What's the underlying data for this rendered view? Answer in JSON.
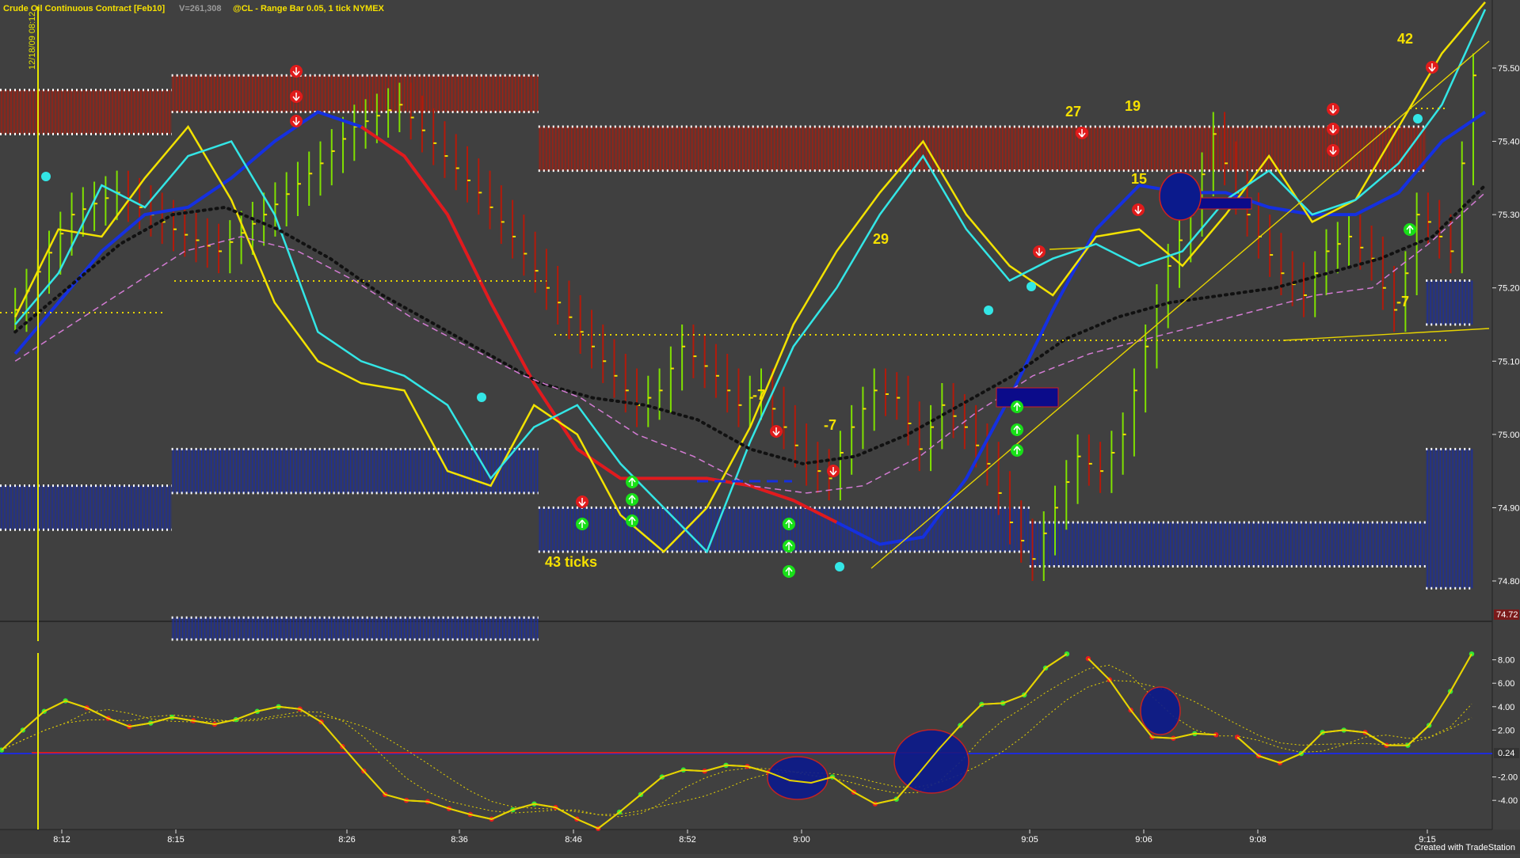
{
  "header": {
    "instrument": "Crude Oil Continuous Contract [Feb10]",
    "volume": "V=261,308",
    "symbol_info": "@CL - Range Bar 0.05, 1 tick  NYMEX",
    "date_stamp": "12/18/09 08:12"
  },
  "footer": {
    "credit": "Created with TradeStation"
  },
  "colors": {
    "background": "#404040",
    "up_bar": "#7fe000",
    "down_bar": "#b31a0a",
    "resistance_zone": "#a31f12",
    "support_zone": "#1d2f9a",
    "slow_ma_up": "#1530e0",
    "slow_ma_down": "#e11b1b",
    "fast_ma": "#f2e200",
    "cyan_ma": "#33e6e6",
    "zero_line": "#1e2bd8"
  },
  "chart_data": [
    {
      "type": "line",
      "title": "Crude Oil Continuous Contract [Feb10]",
      "ylim": [
        74.68,
        75.6
      ],
      "y_ticks": [
        74.8,
        74.9,
        75.0,
        75.1,
        75.2,
        75.3,
        75.4,
        75.5
      ],
      "y_tick_labels": [
        "74.80",
        "74.90",
        "75.00",
        "75.10",
        "75.20",
        "75.30",
        "75.40",
        "75.50"
      ],
      "x_tick_labels": [
        "8:12",
        "8:15",
        "8:26",
        "8:36",
        "8:46",
        "8:52",
        "9:00",
        "9:05",
        "9:06",
        "9:08",
        "9:15"
      ],
      "bar_count": 130,
      "closes": [
        75.17,
        75.3,
        75.33,
        75.28,
        75.25,
        75.3,
        75.37,
        75.42,
        75.45,
        75.38,
        75.33,
        75.27,
        75.2,
        75.14,
        75.08,
        75.04,
        75.06,
        75.12,
        75.08,
        75.04,
        75.06,
        75.01,
        74.96,
        74.94,
        75.01,
        75.06,
        75.05,
        74.98,
        75.04,
        75.01,
        74.96,
        74.88,
        74.83,
        74.9,
        74.97,
        74.95,
        75.0,
        75.12,
        75.23,
        75.3,
        75.41,
        75.33,
        75.27,
        75.22,
        75.19,
        75.25,
        75.27,
        75.24,
        75.2,
        75.17,
        75.22,
        75.3,
        75.29,
        75.27,
        75.25,
        75.37,
        75.44,
        75.49,
        75.58
      ],
      "close_bar_index": [
        0,
        5,
        9,
        14,
        18,
        22,
        27,
        30,
        34,
        38,
        41,
        44,
        47,
        50,
        53,
        55,
        57,
        59,
        62,
        64,
        66,
        68,
        70,
        72,
        74,
        76,
        78,
        80,
        82,
        84,
        86,
        88,
        90,
        92,
        94,
        96,
        98,
        100,
        102,
        104,
        106,
        108,
        110,
        112,
        114,
        116,
        118,
        120,
        121,
        122,
        123,
        124,
        125,
        126,
        127,
        128,
        128,
        129,
        129
      ],
      "series": [
        {
          "values": [
            75.11,
            75.18,
            75.25,
            75.3,
            75.31,
            75.35,
            75.4,
            75.44,
            75.42,
            75.38,
            75.3,
            75.18,
            75.07,
            74.98,
            74.94,
            74.94,
            74.94,
            74.93,
            74.91,
            74.88,
            74.85,
            74.86,
            74.94,
            75.05,
            75.17,
            75.28,
            75.34,
            75.33,
            75.33,
            75.31,
            75.3,
            75.3,
            75.33,
            75.4,
            75.44
          ]
        },
        {
          "values": [
            75.16,
            75.28,
            75.27,
            75.35,
            75.42,
            75.32,
            75.18,
            75.1,
            75.07,
            75.06,
            74.95,
            74.93,
            75.04,
            75.0,
            74.89,
            74.84,
            74.9,
            75.01,
            75.15,
            75.25,
            75.33,
            75.4,
            75.3,
            75.23,
            75.19,
            75.27,
            75.28,
            75.23,
            75.3,
            75.38,
            75.29,
            75.32,
            75.42,
            75.52,
            75.59
          ]
        },
        {
          "values": [
            75.15,
            75.22,
            75.34,
            75.31,
            75.38,
            75.4,
            75.3,
            75.14,
            75.1,
            75.08,
            75.04,
            74.94,
            75.01,
            75.04,
            74.96,
            74.9,
            74.84,
            74.99,
            75.12,
            75.2,
            75.3,
            75.38,
            75.28,
            75.21,
            75.24,
            75.26,
            75.23,
            75.25,
            75.32,
            75.36,
            75.3,
            75.32,
            75.37,
            75.45,
            75.58
          ]
        },
        {
          "values": [
            75.14,
            75.2,
            75.26,
            75.3,
            75.31,
            75.28,
            75.24,
            75.19,
            75.15,
            75.11,
            75.07,
            75.05,
            75.04,
            75.02,
            74.98,
            74.96,
            74.97,
            75.0,
            75.04,
            75.08,
            75.13,
            75.16,
            75.18,
            75.19,
            75.2,
            75.22,
            75.24,
            75.27,
            75.34
          ]
        },
        {
          "values": [
            75.1,
            75.15,
            75.2,
            75.25,
            75.27,
            75.25,
            75.21,
            75.16,
            75.12,
            75.08,
            75.05,
            75.0,
            74.97,
            74.93,
            74.92,
            74.93,
            74.97,
            75.03,
            75.08,
            75.11,
            75.13,
            75.15,
            75.17,
            75.19,
            75.2,
            75.26,
            75.33
          ]
        },
        {
          "values": [
            75.19,
            75.33,
            75.09,
            75.15,
            75.24,
            75.05,
            75.1
          ]
        }
      ],
      "zones": [
        {
          "kind": "resistance",
          "y_top": 75.47,
          "y_bottom": 75.41,
          "x_from": 0,
          "x_to": 28
        },
        {
          "kind": "resistance",
          "y_top": 75.49,
          "y_bottom": 75.44,
          "x_from": 29,
          "x_to": 90
        },
        {
          "kind": "resistance",
          "y_top": 75.42,
          "y_bottom": 75.36,
          "x_from": 91,
          "x_to": 240
        },
        {
          "kind": "support",
          "y_top": 74.93,
          "y_bottom": 74.87,
          "x_from": 0,
          "x_to": 28
        },
        {
          "kind": "support",
          "y_top": 74.98,
          "y_bottom": 74.92,
          "x_from": 29,
          "x_to": 90
        },
        {
          "kind": "support",
          "y_top": 74.75,
          "y_bottom": 74.72,
          "x_from": 29,
          "x_to": 90
        },
        {
          "kind": "support",
          "y_top": 74.9,
          "y_bottom": 74.84,
          "x_from": 91,
          "x_to": 173
        },
        {
          "kind": "support",
          "y_top": 74.88,
          "y_bottom": 74.82,
          "x_from": 174,
          "x_to": 240
        },
        {
          "kind": "support",
          "y_top": 75.21,
          "y_bottom": 75.15,
          "x_from": 241,
          "x_to": 248
        },
        {
          "kind": "support",
          "y_top": 74.98,
          "y_bottom": 74.79,
          "x_from": 241,
          "x_to": 248
        }
      ],
      "annotations": [
        "43 ticks",
        "-7",
        "-7",
        "29",
        "27",
        "19",
        "15",
        "-7",
        "42"
      ]
    },
    {
      "type": "line",
      "title": "",
      "ylim": [
        -6,
        9
      ],
      "y_ticks": [
        8,
        6,
        4,
        2,
        -2,
        -4
      ],
      "y_tick_labels": [
        "8.00",
        "6.00",
        "4.00",
        "2.00",
        "-2.00",
        "-4.00"
      ],
      "current_value_label": "0.24",
      "top_value_label": "74.72",
      "series": [
        {
          "values": [
            0.3,
            2.0,
            3.6,
            4.5,
            3.9,
            3.0,
            2.3,
            2.6,
            3.1,
            2.8,
            2.5,
            2.9,
            3.6,
            4.0,
            3.8,
            2.7,
            0.6,
            -1.5,
            -3.5,
            -4.0,
            -4.1,
            -4.7,
            -5.2,
            -5.6,
            -4.8,
            -4.3,
            -4.6,
            -5.6,
            -6.4,
            -5.0,
            -3.5,
            -2.0,
            -1.4,
            -1.5,
            -1.0,
            -1.1,
            -1.6,
            -2.3,
            -2.5,
            -2.0,
            -3.3,
            -4.3,
            -3.9,
            -1.8,
            0.4,
            2.4,
            4.2,
            4.3,
            5.0,
            7.3,
            8.5,
            8.1,
            6.3,
            3.7,
            1.4,
            1.3,
            1.7,
            1.6,
            1.4,
            -0.2,
            -0.8,
            0.0,
            1.8,
            2.0,
            1.8,
            0.7,
            0.7,
            2.4,
            5.3,
            8.5
          ]
        }
      ]
    }
  ]
}
